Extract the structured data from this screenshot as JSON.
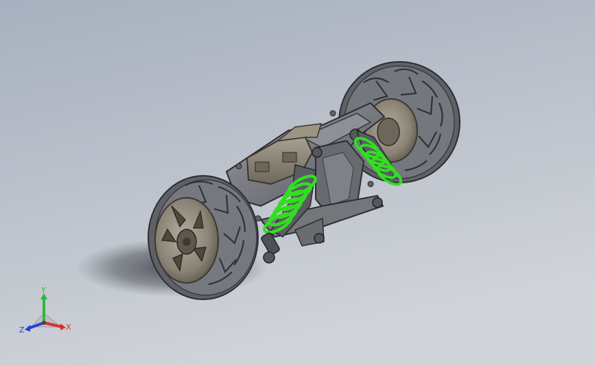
{
  "viewport": {
    "background_top": "#a7b0bf",
    "background_bottom": "#d0d3d8"
  },
  "model": {
    "spring_color": "#33dd22",
    "tire_color": "#6a6d72",
    "rim_color": "#948c7e",
    "frame_color": "#7c7f86"
  },
  "triad": {
    "x_label": "X",
    "y_label": "Y",
    "z_label": "Z",
    "x_color": "#d83030",
    "y_color": "#2fb83a",
    "z_color": "#2a3fd6"
  }
}
